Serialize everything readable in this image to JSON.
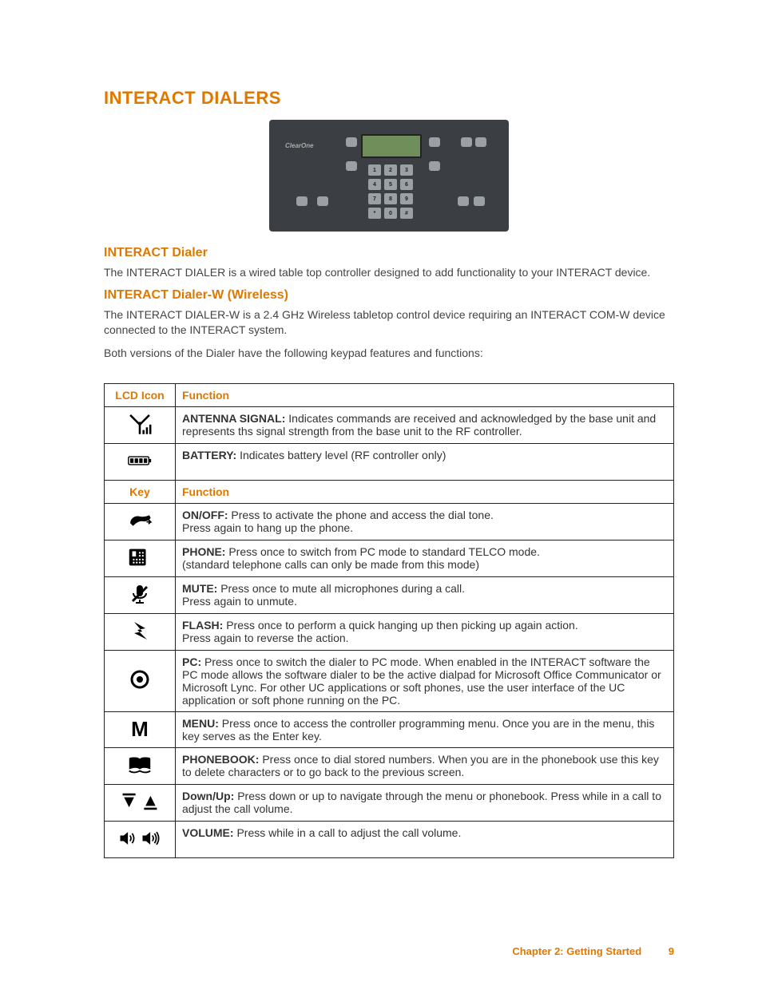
{
  "title": "INTERACT DIALERS",
  "device_brand": "ClearOne",
  "sections": {
    "dialer_heading": "INTERACT Dialer",
    "dialer_body": "The INTERACT DIALER is a wired table top controller designed to add functionality to your INTERACT device.",
    "dialerw_heading": "INTERACT Dialer-W (Wireless)",
    "dialerw_body": "The INTERACT DIALER-W is a 2.4 GHz Wireless tabletop control device requiring an INTERACT COM-W device connected to the INTERACT system.",
    "both_body": "Both versions of the Dialer have the following keypad features and functions:"
  },
  "table": {
    "header1": {
      "col1": "LCD Icon",
      "col2": "Function"
    },
    "header2": {
      "col1": "Key",
      "col2": "Function"
    },
    "rows": [
      {
        "kw": "ANTENNA SIGNAL:",
        "text": " Indicates commands are received and acknowledged by the base unit and represents ths signal strength from the base unit to the RF controller."
      },
      {
        "kw": "BATTERY:",
        "text": " Indicates battery level (RF controller only)"
      },
      {
        "kw": "ON/OFF:",
        "text": " Press to activate the phone and access the dial tone.\nPress again to hang up the phone."
      },
      {
        "kw": "PHONE:",
        "text": " Press once to switch from PC mode to standard TELCO mode.\n(standard telephone calls can only be made from this mode)"
      },
      {
        "kw": "MUTE:",
        "text": " Press once to mute all microphones during a call.\nPress again to unmute."
      },
      {
        "kw": "FLASH:",
        "text": " Press once to perform a quick hanging up then picking up again action.\nPress again to reverse the action."
      },
      {
        "kw": "PC:",
        "text": " Press once to switch the dialer to PC mode. When enabled in the INTERACT software the PC mode allows the software dialer to be the active dialpad for Microsoft Office Communicator or Microsoft Lync. For other UC applications or soft phones, use the user interface of the UC application or soft phone running on the PC."
      },
      {
        "kw": "MENU:",
        "text": " Press once to access the controller programming menu. Once you are in the menu, this key serves as the Enter key."
      },
      {
        "kw": "PHONEBOOK:",
        "text": " Press once to dial stored numbers. When you are in the phonebook use this key to delete characters or to go back to the previous screen."
      },
      {
        "kw": "Down/Up:",
        "text": " Press down or up to navigate through the menu or phonebook. Press while in a call to adjust the call volume."
      },
      {
        "kw": "VOLUME:",
        "text": " Press while in a call to adjust the call volume."
      }
    ]
  },
  "footer": {
    "chapter": "Chapter 2: Getting Started",
    "page": "9"
  }
}
